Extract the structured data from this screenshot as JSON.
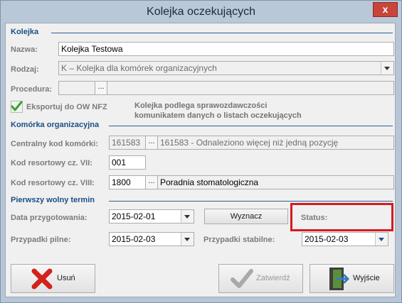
{
  "window": {
    "title": "Kolejka oczekujących",
    "close_symbol": "x"
  },
  "section_kolejka": {
    "title": "Kolejka"
  },
  "nazwa": {
    "label": "Nazwa:",
    "value": "Kolejka Testowa"
  },
  "rodzaj": {
    "label": "Rodzaj:",
    "value": "K – Kolejka dla komórek organizacyjnych"
  },
  "procedura": {
    "label": "Procedura:",
    "value": "",
    "dots": "..."
  },
  "eksport": {
    "label": "Eksportuj do OW NFZ",
    "checked": true
  },
  "note": {
    "line1": "Kolejka podlega sprawozdawczości",
    "line2": "komunikatem danych o listach oczekujących"
  },
  "section_komorka": {
    "title": "Komórka organizacyjna"
  },
  "centralny": {
    "label": "Centralny kod komórki:",
    "code": "161583",
    "dots": "...",
    "description": "161583 - Odnaleziono więcej niż jedną pozycję"
  },
  "kod_vii": {
    "label": "Kod resortowy cz. VII:",
    "value": "001"
  },
  "kod_viii": {
    "label": "Kod resortowy cz. VIII:",
    "value": "1800",
    "dots": "...",
    "description": "Poradnia stomatologiczna"
  },
  "section_termin": {
    "title": "Pierwszy wolny termin"
  },
  "data_przygotowania": {
    "label": "Data przygotowania:",
    "value": "2015-02-01"
  },
  "wyznacz": {
    "label": "Wyznacz"
  },
  "status": {
    "label": "Status:"
  },
  "przypadki_pilne": {
    "label": "Przypadki pilne:",
    "value": "2015-02-03"
  },
  "przypadki_stabilne": {
    "label": "Przypadki stabilne:",
    "value": "2015-02-03"
  },
  "buttons": {
    "delete": "Usuń",
    "confirm": "Zatwierdź",
    "exit": "Wyjście"
  },
  "colors": {
    "section": "#1a4f86",
    "highlight": "#d71920",
    "delete_icon": "#d3211b",
    "check_icon": "#3f9e35"
  }
}
